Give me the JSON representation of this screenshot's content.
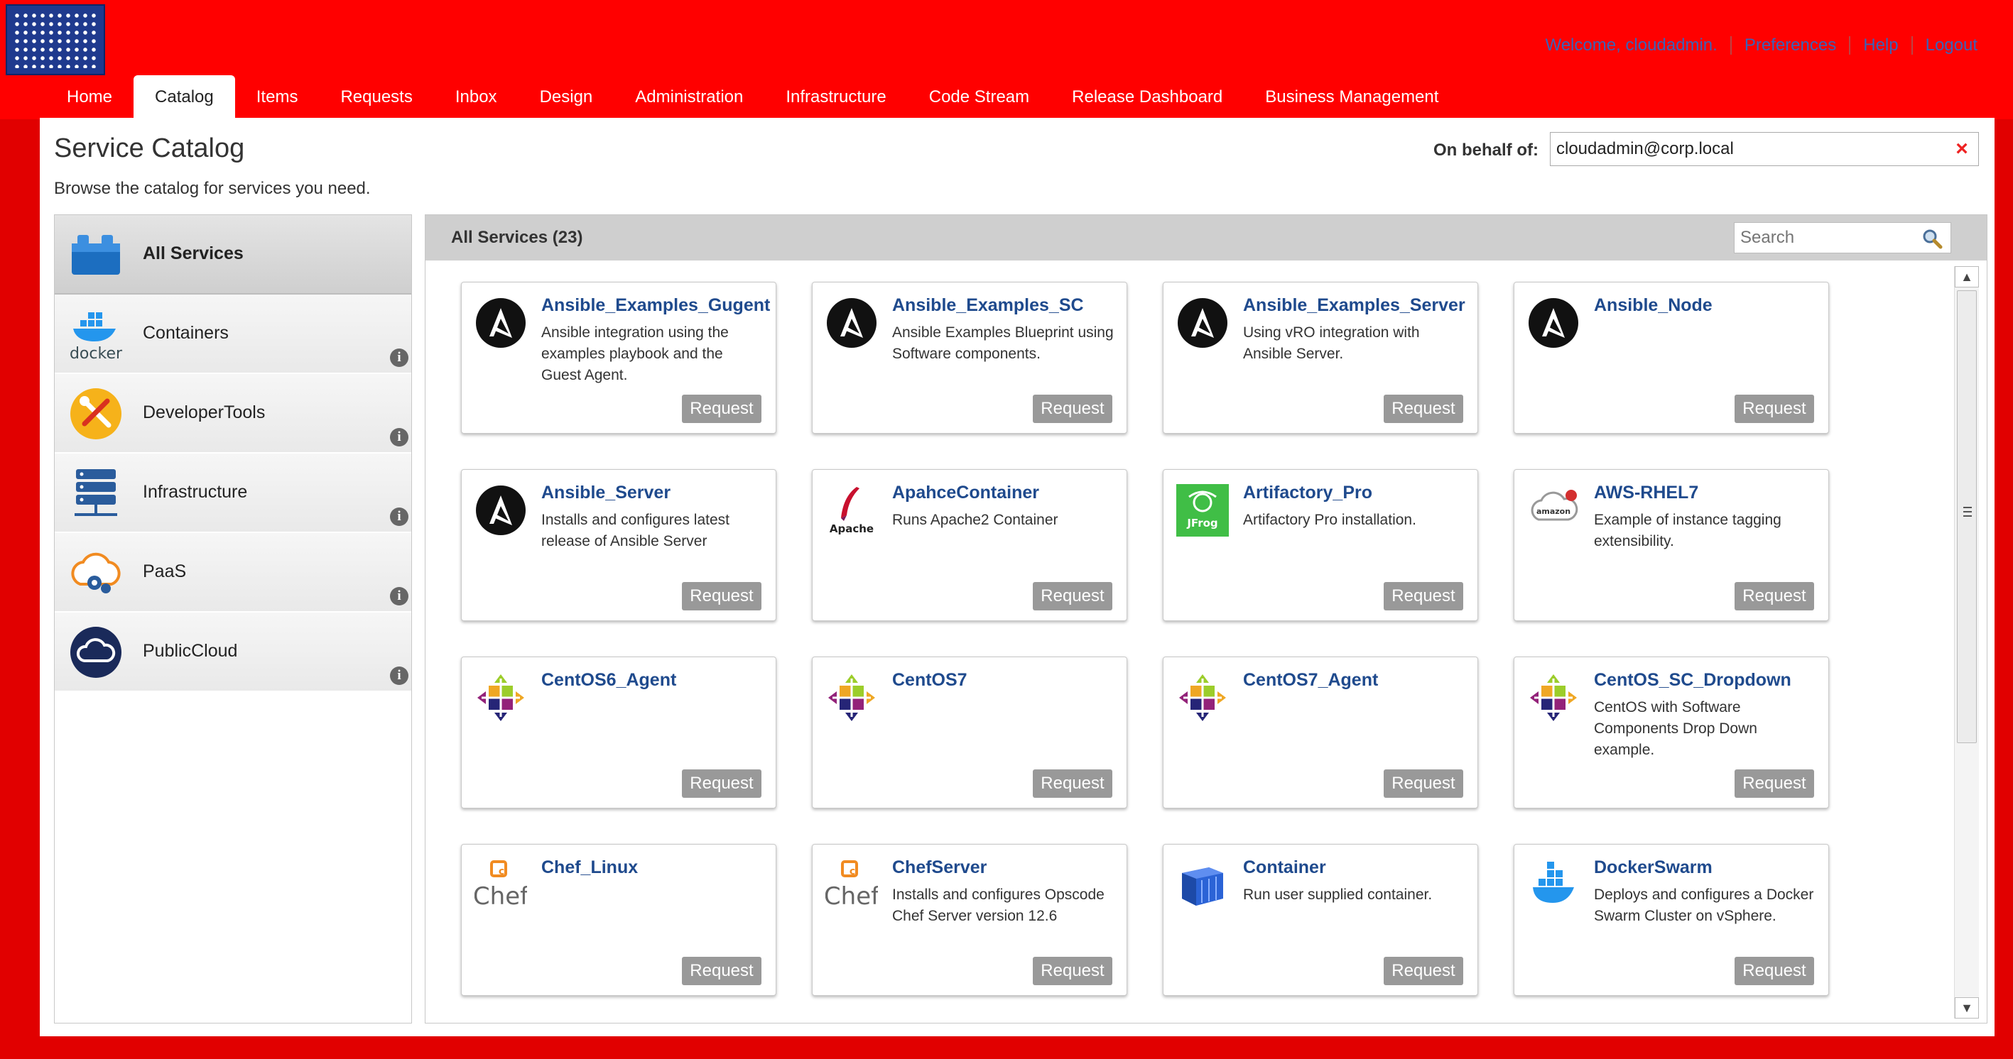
{
  "header": {
    "welcome": "Welcome, cloudadmin.",
    "links": [
      "Preferences",
      "Help",
      "Logout"
    ]
  },
  "nav": {
    "tabs": [
      "Home",
      "Catalog",
      "Items",
      "Requests",
      "Inbox",
      "Design",
      "Administration",
      "Infrastructure",
      "Code Stream",
      "Release Dashboard",
      "Business Management"
    ],
    "active": "Catalog"
  },
  "page": {
    "title": "Service Catalog",
    "subtitle": "Browse the catalog for services you need.",
    "behalf_label": "On behalf of:",
    "behalf_value": "cloudadmin@corp.local"
  },
  "sidebar": {
    "items": [
      {
        "label": "All Services",
        "icon": "blocks-icon",
        "active": true
      },
      {
        "label": "Containers",
        "icon": "docker-icon"
      },
      {
        "label": "DeveloperTools",
        "icon": "tools-icon"
      },
      {
        "label": "Infrastructure",
        "icon": "server-icon"
      },
      {
        "label": "PaaS",
        "icon": "cloud-gear-icon"
      },
      {
        "label": "PublicCloud",
        "icon": "cloud-icon"
      }
    ]
  },
  "main": {
    "title": "All Services (23)",
    "search_placeholder": "Search",
    "request_label": "Request",
    "cards": [
      {
        "name": "Ansible_Examples_Gugent",
        "desc": "Ansible integration using the examples playbook and the Guest Agent.",
        "icon": "ansible"
      },
      {
        "name": "Ansible_Examples_SC",
        "desc": "Ansible Examples Blueprint using Software components.",
        "icon": "ansible"
      },
      {
        "name": "Ansible_Examples_Server",
        "desc": "Using vRO integration with Ansible Server.",
        "icon": "ansible"
      },
      {
        "name": "Ansible_Node",
        "desc": "",
        "icon": "ansible"
      },
      {
        "name": "Ansible_Server",
        "desc": "Installs and configures latest release of Ansible Server",
        "icon": "ansible"
      },
      {
        "name": "ApahceContainer",
        "desc": "Runs Apache2 Container",
        "icon": "apache",
        "icon_text": "Apache"
      },
      {
        "name": "Artifactory_Pro",
        "desc": "Artifactory Pro installation.",
        "icon": "jfrog",
        "icon_text": "JFrog"
      },
      {
        "name": "AWS-RHEL7",
        "desc": "Example of instance tagging extensibility.",
        "icon": "aws",
        "icon_text": "amazon"
      },
      {
        "name": "CentOS6_Agent",
        "desc": "",
        "icon": "centos"
      },
      {
        "name": "CentOS7",
        "desc": "",
        "icon": "centos"
      },
      {
        "name": "CentOS7_Agent",
        "desc": "",
        "icon": "centos"
      },
      {
        "name": "CentOS_SC_Dropdown",
        "desc": "CentOS with Software Components Drop Down example.",
        "icon": "centos"
      },
      {
        "name": "Chef_Linux",
        "desc": "",
        "icon": "chef",
        "icon_text": "Chef"
      },
      {
        "name": "ChefServer",
        "desc": "Installs and configures Opscode Chef Server version 12.6",
        "icon": "chef",
        "icon_text": "Chef"
      },
      {
        "name": "Container",
        "desc": "Run user supplied container.",
        "icon": "container"
      },
      {
        "name": "DockerSwarm",
        "desc": "Deploys and configures a Docker Swarm Cluster on vSphere.",
        "icon": "docker-swarm"
      }
    ]
  },
  "colors": {
    "banner": "#ff0000",
    "link_blue": "#1f4a8d",
    "request_gray": "#999999"
  }
}
